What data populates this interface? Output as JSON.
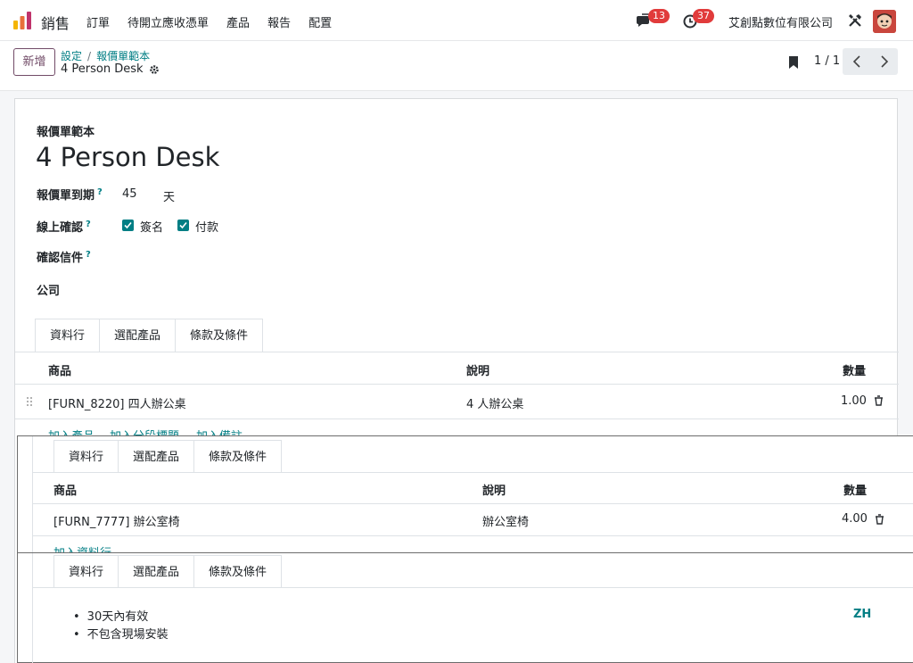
{
  "navbar": {
    "app_name": "銷售",
    "menu": [
      "訂單",
      "待開立應收憑單",
      "產品",
      "報告",
      "配置"
    ],
    "messages_count": "13",
    "activities_count": "37",
    "company": "艾創點數位有限公司"
  },
  "control": {
    "new_label": "新增",
    "breadcrumb": [
      "設定",
      "報價單範本"
    ],
    "current": "4 Person Desk",
    "pager": "1 / 1"
  },
  "form": {
    "title_label": "報價單範本",
    "title": "4 Person Desk",
    "expiry_label": "報價單到期",
    "expiry_value": "45",
    "expiry_unit": "天",
    "online_label": "線上確認",
    "sign_label": "簽名",
    "pay_label": "付款",
    "mail_label": "確認信件",
    "company_label": "公司",
    "help_mark": "?"
  },
  "tabs": [
    "資料行",
    "選配產品",
    "條款及條件"
  ],
  "lines_table": {
    "headers": [
      "商品",
      "說明",
      "數量"
    ],
    "rows": [
      {
        "product": "[FURN_8220] 四人辦公桌",
        "desc": "4 人辦公桌",
        "qty": "1.00"
      }
    ],
    "add_links": [
      "加入產品",
      "加入分段標題",
      "加入備註"
    ]
  },
  "optional_table": {
    "headers": [
      "商品",
      "說明",
      "數量"
    ],
    "rows": [
      {
        "product": "[FURN_7777] 辦公室椅",
        "desc": "辦公室椅",
        "qty": "4.00"
      }
    ],
    "add_link": "加入資料行"
  },
  "terms": {
    "items": [
      "30天內有效",
      "不包含現場安裝"
    ],
    "lang": "ZH"
  },
  "colors": {
    "accent": "#017e84",
    "primary": "#714b67",
    "badge": "#e13b3b"
  }
}
